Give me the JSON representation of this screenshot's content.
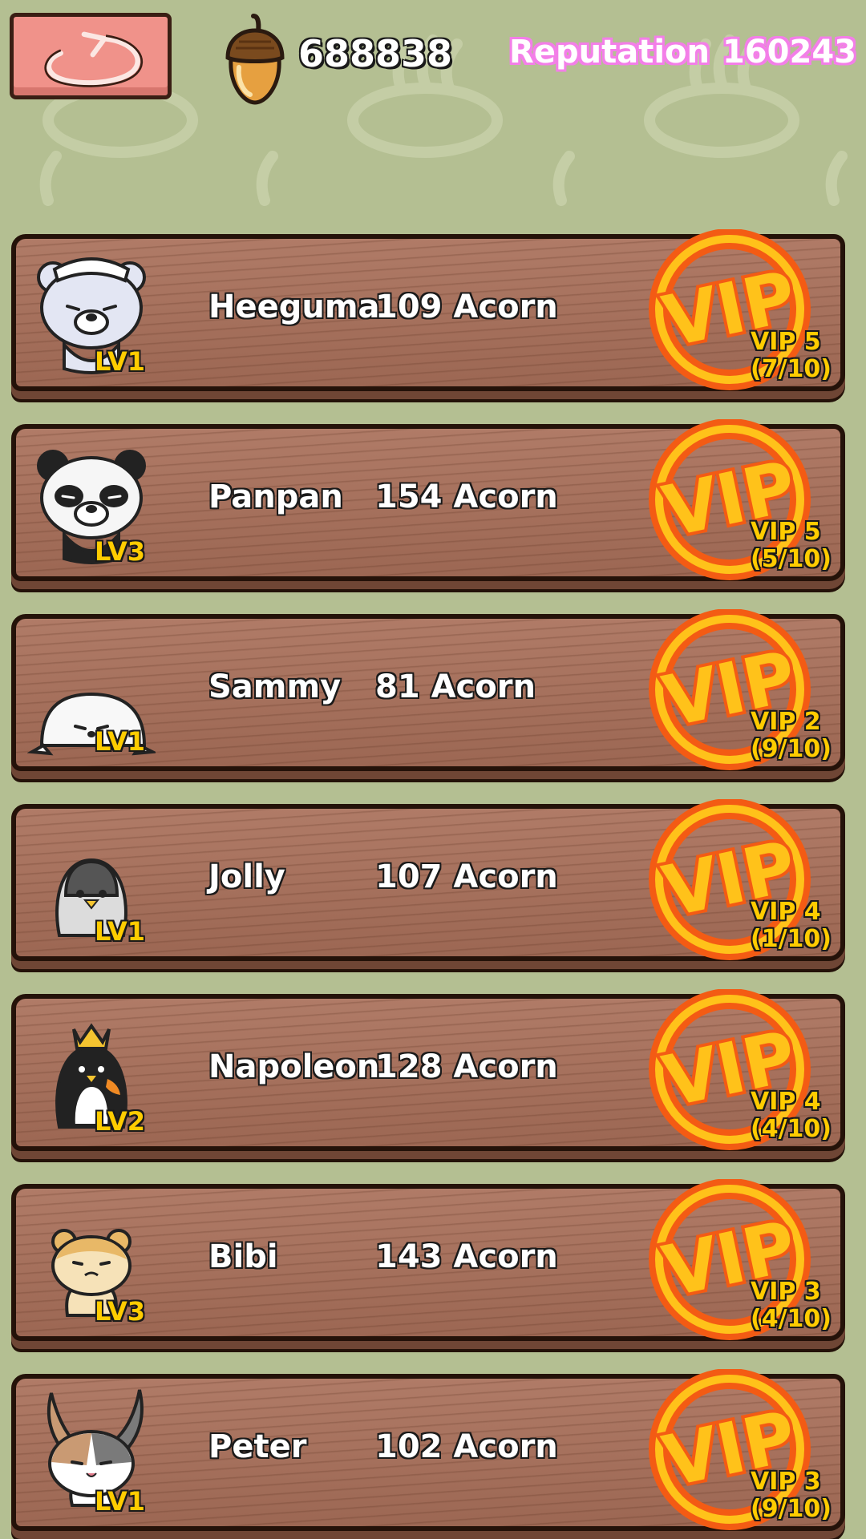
{
  "header": {
    "acorn_count": "688838",
    "reputation_label": "Reputation",
    "reputation_value": "160243",
    "back_icon": "undo-arrow-icon",
    "acorn_icon": "acorn-icon"
  },
  "colors": {
    "background": "#b4bf92",
    "plank": "#a8725e",
    "back_button": "#f0928a",
    "vip_orange": "#f35b14",
    "vip_yellow": "#ffc21a",
    "level_text": "#ffcc00",
    "reputation_outline": "#f37fe8"
  },
  "customers": [
    {
      "name": "Heeguma",
      "acorns": "109 Acorn",
      "level": "LV1",
      "vip_tier": "VIP 5",
      "vip_progress": "(7/10)",
      "avatar": "white-bear-chef-icon"
    },
    {
      "name": "Panpan",
      "acorns": "154 Acorn",
      "level": "LV3",
      "vip_tier": "VIP 5",
      "vip_progress": "(5/10)",
      "avatar": "panda-icon"
    },
    {
      "name": "Sammy",
      "acorns": "81 Acorn",
      "level": "LV1",
      "vip_tier": "VIP 2",
      "vip_progress": "(9/10)",
      "avatar": "seal-icon"
    },
    {
      "name": "Jolly",
      "acorns": "107 Acorn",
      "level": "LV1",
      "vip_tier": "VIP 4",
      "vip_progress": "(1/10)",
      "avatar": "penguin-chick-icon"
    },
    {
      "name": "Napoleon",
      "acorns": "128 Acorn",
      "level": "LV2",
      "vip_tier": "VIP 4",
      "vip_progress": "(4/10)",
      "avatar": "king-penguin-icon"
    },
    {
      "name": "Bibi",
      "acorns": "143 Acorn",
      "level": "LV3",
      "vip_tier": "VIP 3",
      "vip_progress": "(4/10)",
      "avatar": "hamster-icon"
    },
    {
      "name": "Peter",
      "acorns": "102 Acorn",
      "level": "LV1",
      "vip_tier": "VIP 3",
      "vip_progress": "(9/10)",
      "avatar": "rabbit-icon"
    }
  ],
  "vip_badge_text": "VIP"
}
